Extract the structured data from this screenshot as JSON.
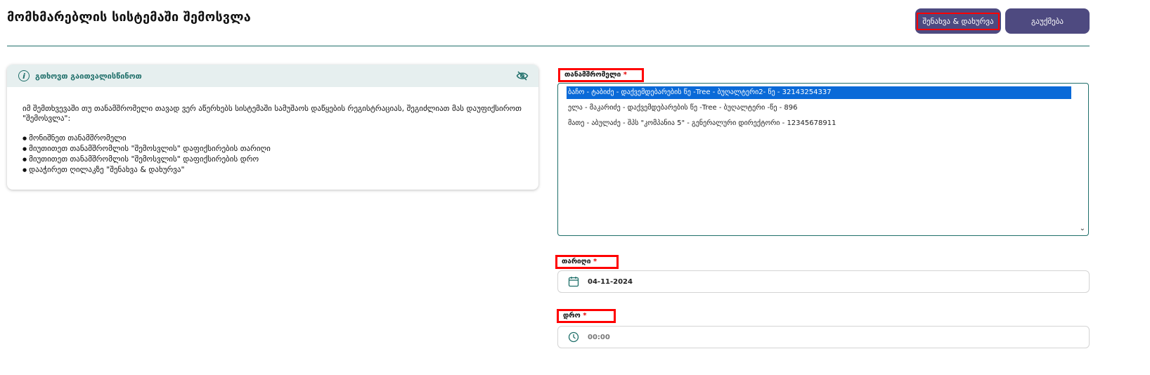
{
  "header": {
    "title": "მომხმარებლის სისტემაში შემოსვლა",
    "save_label": "შენახვა & დახურვა",
    "cancel_label": "გაუქმება"
  },
  "info": {
    "title": "გთხოვთ გაითვალისწინოთ",
    "paragraph": "იმ შემთხვევაში თუ თანამშრომელი თავად ვერ აწერხებს სისტემაში სამუშაოს დაწყების რეგისტრაციას, შეგიძლიათ მას დაუფიქსიროთ \"შემოსვლა\":",
    "bullets": [
      "მონიშნეთ თანამშრომელი",
      "მიუთითეთ თანამშრომლის \"შემოსვლის\" დაფიქსირების თარიღი",
      "მიუთითეთ თანამშრომლის \"შემოსვლის\" დაფიქსირების დრო",
      "დააჭირეთ ღილაკზე \"შენახვა & დახურვა\""
    ]
  },
  "employee": {
    "label": "თანამშრომელი",
    "required_mark": "*",
    "options": [
      "ბაჩო - ტაბიძე - დაქვემდებარების წე -Tree - ბუღალტერი2- წე - 32143254337",
      "ელა - მაკარიძე - დაქვემდებარების წე -Tree - ბუღალტერი -წე - 896",
      "მათე - აბულაძე - შპს \"კომპანია 5\" - გენერალური დირექტორი - 12345678911"
    ],
    "selected_index": 0
  },
  "date": {
    "label": "თარიღი",
    "required_mark": "*",
    "value": "04-11-2024",
    "icon": "calendar-icon"
  },
  "time": {
    "label": "დრო",
    "required_mark": "*",
    "value": "00:00",
    "icon": "clock-icon"
  },
  "colors": {
    "accent": "#1f6f6a",
    "button": "#4e4a80",
    "highlight": "#ff0000",
    "selected": "#0a6ad8"
  }
}
